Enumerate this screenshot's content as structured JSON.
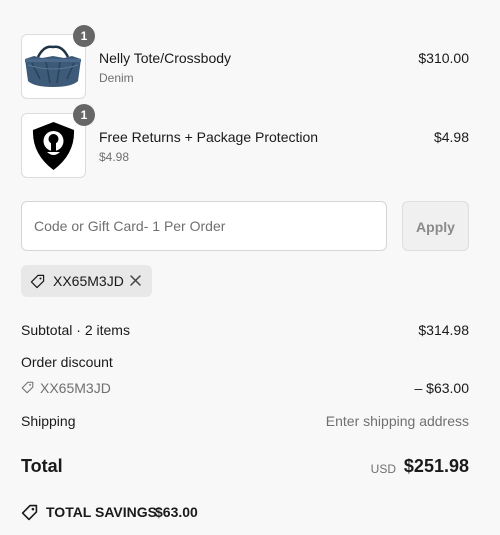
{
  "line_items": [
    {
      "title": "Nelly Tote/Crossbody",
      "variant": "Denim",
      "price": "$310.00",
      "quantity": "1",
      "image_icon": "denim-tote-bag"
    },
    {
      "title": "Free Returns + Package Protection",
      "variant": "$4.98",
      "price": "$4.98",
      "quantity": "1",
      "image_icon": "shield-keyhole"
    }
  ],
  "discount": {
    "placeholder": "Code or Gift Card- 1 Per Order",
    "value": "",
    "apply_label": "Apply",
    "applied_code": "XX65M3JD"
  },
  "summary": {
    "subtotal_label": "Subtotal · 2 items",
    "subtotal_value": "$314.98",
    "order_discount_label": "Order discount",
    "discount_code": "XX65M3JD",
    "discount_value": "– $63.00",
    "shipping_label": "Shipping",
    "shipping_value": "Enter shipping address",
    "total_label": "Total",
    "currency": "USD",
    "total_value": "$251.98",
    "savings_label": "TOTAL SAVINGS",
    "savings_value": "$63.00"
  },
  "colors": {
    "background": "#f8f8f8",
    "text": "#1a1a1a",
    "muted": "#707070",
    "badge": "#666666",
    "chip": "#e8e8e8"
  }
}
